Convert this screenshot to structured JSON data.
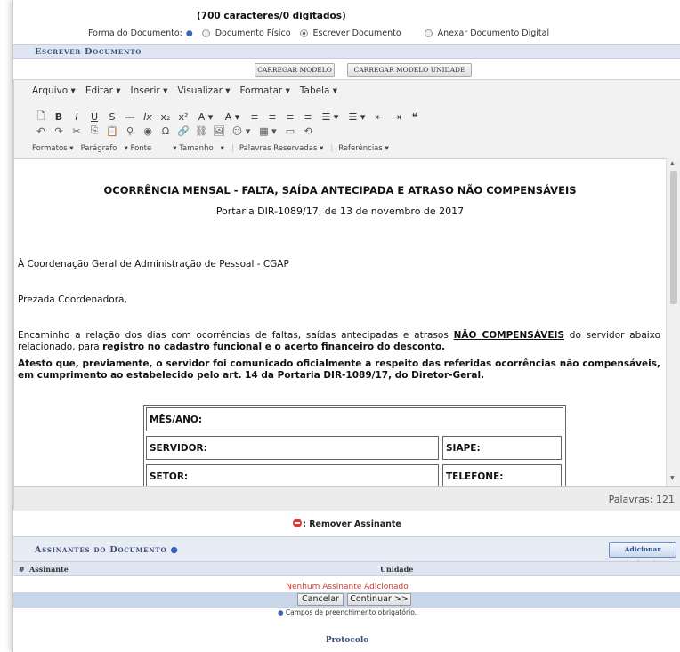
{
  "form": {
    "char_count": "(700 caracteres/0 digitados)",
    "label": "Forma do Documento:",
    "options": [
      "Documento Físico",
      "Escrever Documento",
      "Anexar Documento Digital"
    ],
    "selected": "Escrever Documento"
  },
  "section_title": "Escrever Documento",
  "buttons": {
    "load_model": "CARREGAR MODELO",
    "load_model_unit": "CARREGAR MODELO UNIDADE"
  },
  "editor": {
    "menu": [
      "Arquivo ▾",
      "Editar ▾",
      "Inserir ▾",
      "Visualizar ▾",
      "Formatar ▾",
      "Tabela ▾"
    ],
    "toolbar_row1": [
      "🗋",
      "B",
      "I",
      "U",
      "S",
      "—",
      "Ix",
      "x₂",
      "x²",
      "A ▾",
      "A ▾",
      "≡",
      "≡",
      "≡",
      "≡",
      "☰ ▾",
      "☰ ▾",
      "⇤",
      "⇥",
      "❝"
    ],
    "toolbar_row2": [
      "↶",
      "↷",
      "✂",
      "⎘",
      "📋",
      "⚲",
      "◉",
      "Ω",
      "🔗",
      "⛓",
      "🖼",
      "☺ ▾",
      "▦ ▾",
      "▭",
      "⟲"
    ],
    "format_row": [
      "Formatos ▾",
      "Parágrafo",
      "▾ Fonte",
      "▾ Tamanho",
      "▾",
      "Palavras Reservadas ▾",
      "Referências ▾"
    ],
    "word_count": "Palavras: 121"
  },
  "document": {
    "title": "OCORRÊNCIA MENSAL - FALTA, SAÍDA ANTECIPADA E ATRASO NÃO COMPENSÁVEIS",
    "subtitle": "Portaria DIR-1089/17, de 13 de novembro de 2017",
    "recipient": "À Coordenação Geral de Administração de Pessoal - CGAP",
    "greeting": "Prezada Coordenadora,",
    "para1_a": "Encaminho a relação dos dias com ocorrências de faltas, saídas antecipadas e atrasos ",
    "para1_b": "NÃO COMPENSÁVEIS",
    "para1_c": " do servidor abaixo relacionado, para ",
    "para1_d": "registro no cadastro funcional e o acerto financeiro do desconto.",
    "para2": "Atesto que, previamente, o servidor foi comunicado oficialmente a respeito das referidas ocorrências não compensáveis, em cumprimento ao estabelecido pelo art. 14 da Portaria DIR-1089/17, do Diretor-Geral.",
    "table": {
      "mes_ano": "MÊS/ANO:",
      "servidor": "SERVIDOR:",
      "siape": "SIAPE:",
      "setor": "SETOR:",
      "telefone": "TELEFONE:"
    }
  },
  "remove_signer": ": Remover Assinante",
  "signers": {
    "title": "Assinantes do Documento",
    "add_button": "Adicionar Assinante",
    "col_num": "#",
    "col_signer": "Assinante",
    "col_unit": "Unidade",
    "empty": "Nenhum Assinante Adicionado"
  },
  "footer": {
    "cancel": "Cancelar",
    "continue": "Continuar >>",
    "required_note": "Campos de preenchimento obrigatório.",
    "protocolo": "Protocolo"
  }
}
